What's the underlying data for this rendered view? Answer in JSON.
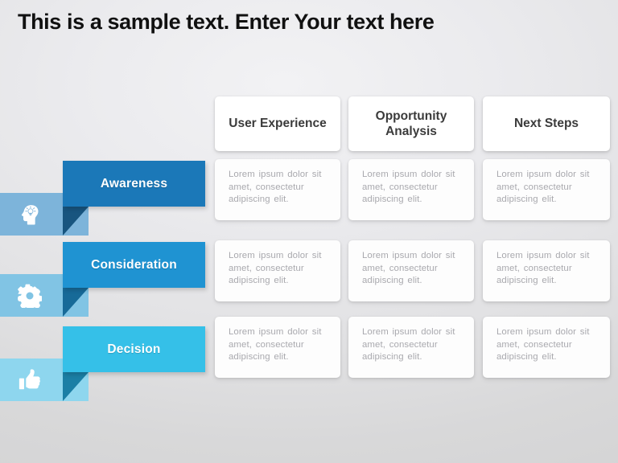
{
  "slide": {
    "title": "This is a sample text. Enter Your text here",
    "background_top_color": "#f2f2f4",
    "background_bottom_color": "#d4d4d5"
  },
  "columns": [
    {
      "label": "User Experience"
    },
    {
      "label": "Opportunity Analysis"
    },
    {
      "label": "Next Steps"
    }
  ],
  "rows": [
    {
      "label": "Awareness",
      "icon": "head-lightbulb-icon",
      "ribbon_color": "#1b78b8",
      "fold_color": "#18557f",
      "band_color": "#7db4da",
      "cells": [
        "Lorem ipsum dolor sit amet, consectetur adipiscing  elit.",
        "Lorem ipsum dolor sit amet, consectetur adipiscing  elit.",
        "Lorem ipsum dolor sit amet, consectetur adipiscing  elit."
      ]
    },
    {
      "label": "Consideration",
      "icon": "gear-icon",
      "ribbon_color": "#1f93d2",
      "fold_color": "#176a98",
      "band_color": "#81c4e4",
      "cells": [
        "Lorem ipsum dolor sit amet, consectetur adipiscing  elit.",
        "Lorem ipsum dolor sit amet, consectetur adipiscing  elit.",
        "Lorem ipsum dolor sit amet, consectetur adipiscing  elit."
      ]
    },
    {
      "label": "Decision",
      "icon": "thumbs-up-icon",
      "ribbon_color": "#35c0e8",
      "fold_color": "#1b7fa5",
      "band_color": "#8ed6ee",
      "cells": [
        "Lorem ipsum dolor sit amet, consectetur adipiscing  elit.",
        "Lorem ipsum dolor sit amet, consectetur adipiscing  elit.",
        "Lorem ipsum dolor sit amet, consectetur adipiscing  elit."
      ]
    }
  ]
}
